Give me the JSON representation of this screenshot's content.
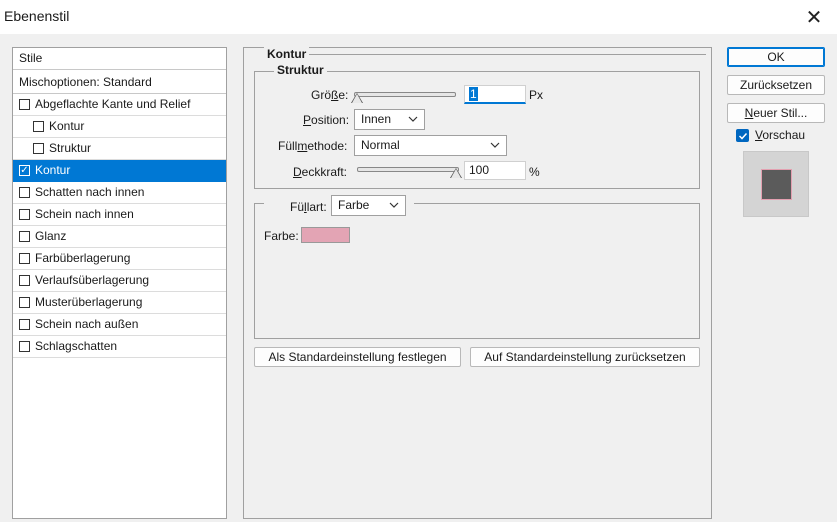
{
  "window": {
    "title": "Ebenenstil",
    "close_glyph": "✕"
  },
  "styles": {
    "header": "Stile",
    "blend_options": "Mischoptionen: Standard",
    "items": [
      {
        "label": "Abgeflachte Kante und Relief",
        "checked": false,
        "sub": false,
        "selected": false
      },
      {
        "label": "Kontur",
        "checked": false,
        "sub": true,
        "selected": false
      },
      {
        "label": "Struktur",
        "checked": false,
        "sub": true,
        "selected": false
      },
      {
        "label": "Kontur",
        "checked": true,
        "sub": false,
        "selected": true
      },
      {
        "label": "Schatten nach innen",
        "checked": false,
        "sub": false,
        "selected": false
      },
      {
        "label": "Schein nach innen",
        "checked": false,
        "sub": false,
        "selected": false
      },
      {
        "label": "Glanz",
        "checked": false,
        "sub": false,
        "selected": false
      },
      {
        "label": "Farbüberlagerung",
        "checked": false,
        "sub": false,
        "selected": false
      },
      {
        "label": "Verlaufsüberlagerung",
        "checked": false,
        "sub": false,
        "selected": false
      },
      {
        "label": "Musterüberlagerung",
        "checked": false,
        "sub": false,
        "selected": false
      },
      {
        "label": "Schein nach außen",
        "checked": false,
        "sub": false,
        "selected": false
      },
      {
        "label": "Schlagschatten",
        "checked": false,
        "sub": false,
        "selected": false
      }
    ]
  },
  "panel": {
    "title": "Kontur",
    "structure": {
      "title": "Struktur",
      "size": {
        "label_pre": "Grö",
        "label_u": "ß",
        "label_post": "e:",
        "value": "1",
        "unit": "Px",
        "slider_fraction": 0.0
      },
      "position": {
        "label_u": "P",
        "label_post": "osition:",
        "value": "Innen"
      },
      "blend_mode": {
        "label_pre": "Füll",
        "label_u": "m",
        "label_post": "ethode:",
        "value": "Normal"
      },
      "opacity": {
        "label_u": "D",
        "label_post": "eckkraft:",
        "value": "100",
        "unit": "%",
        "slider_fraction": 1.0
      }
    },
    "fill": {
      "type_label_pre": "Fü",
      "type_label_u": "l",
      "type_label_post": "lart:",
      "type_value": "Farbe",
      "color_label": "Farbe:",
      "color": "#e3a4b4"
    },
    "buttons": {
      "make_default": "Als Standardeinstellung festlegen",
      "reset_default": "Auf Standardeinstellung zurücksetzen"
    }
  },
  "actions": {
    "ok": "OK",
    "reset": "Zurücksetzen",
    "new_style_u": "N",
    "new_style_post": "euer Stil...",
    "preview_u": "V",
    "preview_post": "orschau",
    "preview_checked": true
  },
  "colors": {
    "accent": "#0078d4",
    "stroke": "#e3a0b0",
    "preview_fill": "#5b5b5b"
  }
}
